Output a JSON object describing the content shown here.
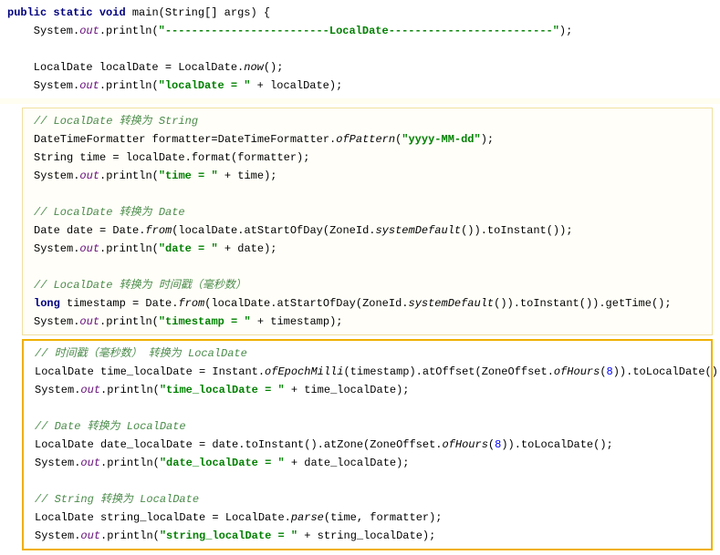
{
  "block1": {
    "l1_kw1": "public",
    "l1_kw2": "static",
    "l1_kw3": "void",
    "l1_rest": " main(String[] args) {",
    "l2_a": "    System.",
    "l2_out": "out",
    "l2_b": ".println(",
    "l2_str1": "\"-------------------------",
    "l2_str2": "LocalDate",
    "l2_str3": "-------------------------\"",
    "l2_c": ");",
    "l3_a": "    LocalDate localDate = LocalDate.",
    "l3_i": "now",
    "l3_b": "();",
    "l4_a": "    System.",
    "l4_out": "out",
    "l4_b": ".println(",
    "l4_str": "\"localDate = \"",
    "l4_c": " + localDate);"
  },
  "block2": {
    "c1": "// LocalDate 转换为 String",
    "l1_a": "DateTimeFormatter formatter=DateTimeFormatter.",
    "l1_i": "ofPattern",
    "l1_b": "(",
    "l1_str": "\"yyyy-MM-dd\"",
    "l1_c": ");",
    "l2": "String time = localDate.format(formatter);",
    "l3_a": "System.",
    "l3_out": "out",
    "l3_b": ".println(",
    "l3_str": "\"time = \"",
    "l3_c": " + time);",
    "c2": "// LocalDate 转换为 Date",
    "l4_a": "Date date = Date.",
    "l4_i": "from",
    "l4_b": "(localDate.atStartOfDay(ZoneId.",
    "l4_i2": "systemDefault",
    "l4_c": "()).toInstant());",
    "l5_a": "System.",
    "l5_out": "out",
    "l5_b": ".println(",
    "l5_str": "\"date = \"",
    "l5_c": " + date);",
    "c3": "// LocalDate 转换为 时间戳（毫秒数）",
    "l6_kw": "long",
    "l6_a": " timestamp = Date.",
    "l6_i": "from",
    "l6_b": "(localDate.atStartOfDay(ZoneId.",
    "l6_i2": "systemDefault",
    "l6_c": "()).toInstant()).getTime();",
    "l7_a": "System.",
    "l7_out": "out",
    "l7_b": ".println(",
    "l7_str": "\"timestamp = \"",
    "l7_c": " + timestamp);"
  },
  "block3": {
    "c1": "// 时间戳（毫秒数） 转换为 LocalDate",
    "l1_a": "LocalDate time_localDate = Instant.",
    "l1_i": "ofEpochMilli",
    "l1_b": "(timestamp).atOffset(ZoneOffset.",
    "l1_i2": "ofHours",
    "l1_c": "(",
    "l1_num": "8",
    "l1_d": ")).toLocalDate();",
    "l2_a": "System.",
    "l2_out": "out",
    "l2_b": ".println(",
    "l2_str": "\"time_localDate = \"",
    "l2_c": " + time_localDate);",
    "c2": "// Date 转换为 LocalDate",
    "l3_a": "LocalDate date_localDate = date.toInstant().atZone(ZoneOffset.",
    "l3_i": "ofHours",
    "l3_b": "(",
    "l3_num": "8",
    "l3_c": ")).toLocalDate();",
    "l4_a": "System.",
    "l4_out": "out",
    "l4_b": ".println(",
    "l4_str": "\"date_localDate = \"",
    "l4_c": " + date_localDate);",
    "c3": "// String 转换为 LocalDate",
    "l5_a": "LocalDate string_localDate = LocalDate.",
    "l5_i": "parse",
    "l5_b": "(time, formatter);",
    "l6_a": "System.",
    "l6_out": "out",
    "l6_b": ".println(",
    "l6_str": "\"string_localDate = \"",
    "l6_c": " + string_localDate);"
  }
}
